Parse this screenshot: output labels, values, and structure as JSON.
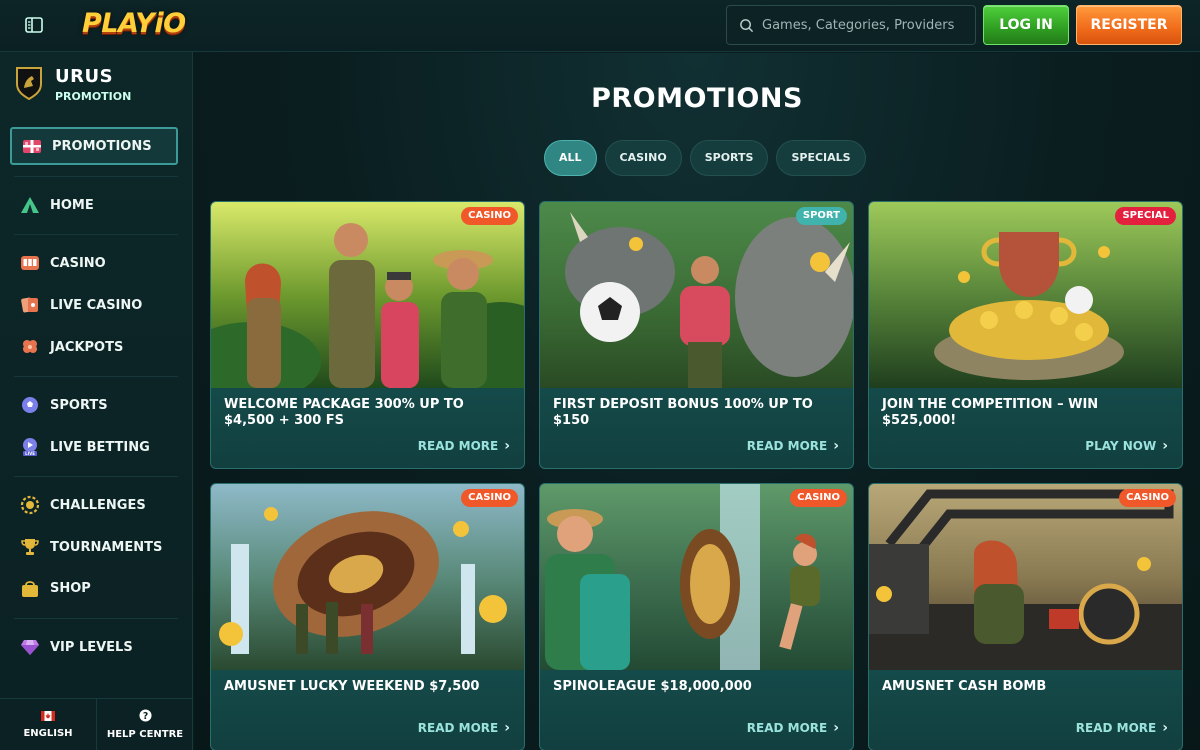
{
  "header": {
    "logo_text": "PLAYiO",
    "search_placeholder": "Games, Categories, Providers",
    "login_label": "LOG IN",
    "register_label": "REGISTER"
  },
  "sidebar": {
    "brand_title": "URUS",
    "brand_subtitle": "PROMOTION",
    "items": [
      {
        "label": "PROMOTIONS",
        "icon": "gift-icon",
        "active": true
      },
      {
        "label": "HOME",
        "icon": "tent-icon"
      },
      {
        "label": "CASINO",
        "icon": "slot-machine-icon"
      },
      {
        "label": "LIVE CASINO",
        "icon": "cards-icon"
      },
      {
        "label": "JACKPOTS",
        "icon": "clover-icon"
      },
      {
        "label": "SPORTS",
        "icon": "soccer-ball-icon"
      },
      {
        "label": "LIVE BETTING",
        "icon": "live-play-icon"
      },
      {
        "label": "CHALLENGES",
        "icon": "medal-icon"
      },
      {
        "label": "TOURNAMENTS",
        "icon": "trophy-icon"
      },
      {
        "label": "SHOP",
        "icon": "shopping-bag-icon"
      },
      {
        "label": "VIP LEVELS",
        "icon": "diamond-icon"
      }
    ],
    "footer": {
      "language_label": "ENGLISH",
      "help_label": "HELP CENTRE"
    }
  },
  "main": {
    "title": "PROMOTIONS",
    "filters": [
      "ALL",
      "CASINO",
      "SPORTS",
      "SPECIALS"
    ],
    "active_filter": "ALL",
    "cards": [
      {
        "badge": "CASINO",
        "badge_color": "#f0582a",
        "title": "WELCOME PACKAGE 300% UP TO $4,500 + 300 FS",
        "cta": "READ MORE"
      },
      {
        "badge": "SPORT",
        "badge_color": "#3fb3ac",
        "title": "FIRST DEPOSIT BONUS 100% UP TO $150",
        "cta": "READ MORE"
      },
      {
        "badge": "SPECIAL",
        "badge_color": "#e3203e",
        "title": "JOIN THE COMPETITION – WIN $525,000!",
        "cta": "PLAY NOW"
      },
      {
        "badge": "CASINO",
        "badge_color": "#f0582a",
        "title": "AMUSNET LUCKY WEEKEND $7,500",
        "cta": "READ MORE"
      },
      {
        "badge": "CASINO",
        "badge_color": "#f0582a",
        "title": "SPINOLEAGUE $18,000,000",
        "cta": "READ MORE"
      },
      {
        "badge": "CASINO",
        "badge_color": "#f0582a",
        "title": "AMUSNET CASH BOMB",
        "cta": "READ MORE"
      }
    ]
  },
  "colors": {
    "accent_teal": "#2f8683",
    "login_green": "#2f9e22",
    "register_orange": "#f06b1a",
    "badge_casino": "#f0582a",
    "badge_sport": "#3fb3ac",
    "badge_special": "#e3203e"
  }
}
